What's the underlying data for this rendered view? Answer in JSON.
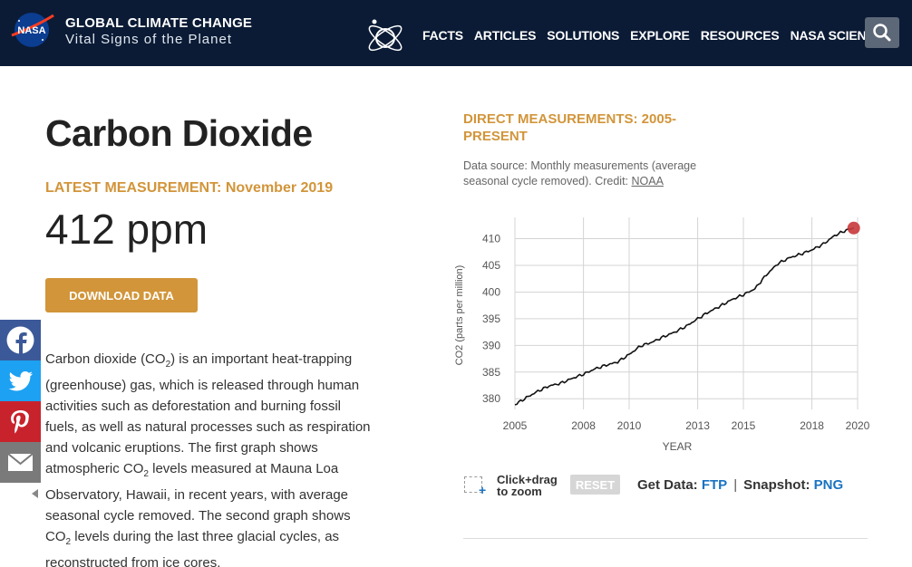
{
  "header": {
    "logo_text": "NASA",
    "title": "GLOBAL CLIMATE CHANGE",
    "subtitle": "Vital Signs of the Planet",
    "nav": [
      "FACTS",
      "ARTICLES",
      "SOLUTIONS",
      "EXPLORE",
      "RESOURCES",
      "NASA SCIENCE"
    ]
  },
  "main": {
    "title": "Carbon Dioxide",
    "latest_label": "LATEST MEASUREMENT: November 2019",
    "value": "412 ppm",
    "download_label": "DOWNLOAD DATA",
    "description": {
      "p1": "Carbon dioxide (CO",
      "sub": "2",
      "p2": ") is an important heat-trapping (greenhouse) gas, which is released through human activities such as deforestation and burning fossil fuels, as well as natural processes such as respiration and volcanic eruptions. The first graph shows atmospheric CO",
      "p3": " levels measured at Mauna Loa Observatory, Hawaii, in recent years, with average seasonal cycle removed. The second graph shows CO",
      "p4": " levels during the last three glacial cycles, as reconstructed from ice cores."
    }
  },
  "social": [
    "facebook-icon",
    "twitter-icon",
    "pinterest-icon",
    "email-icon"
  ],
  "chart_panel": {
    "heading": "DIRECT MEASUREMENTS: 2005-PRESENT",
    "source_text": "Data source: Monthly measurements (average seasonal cycle removed). Credit:",
    "source_link": "NOAA",
    "zoom_text_1": "Click+drag",
    "zoom_text_2": "to zoom",
    "reset_label": "RESET",
    "get_data_label": "Get Data:",
    "ftp_label": "FTP",
    "separator": "|",
    "snapshot_label": "Snapshot:",
    "png_label": "PNG"
  },
  "colors": {
    "header_bg": "#0b1b35",
    "accent": "#d2953a",
    "link": "#1a73c2",
    "highlight_point": "#c8393a"
  },
  "chart_data": {
    "type": "line",
    "title": "",
    "xlabel": "YEAR",
    "ylabel": "CO2 (parts per million)",
    "xlim": [
      2005,
      2020
    ],
    "ylim": [
      378,
      414
    ],
    "xticks": [
      2005,
      2008,
      2010,
      2013,
      2015,
      2018,
      2020
    ],
    "yticks": [
      380,
      385,
      390,
      395,
      400,
      405,
      410
    ],
    "grid": true,
    "x": [
      2005.0,
      2005.5,
      2006.0,
      2006.5,
      2007.0,
      2007.5,
      2008.0,
      2008.5,
      2009.0,
      2009.5,
      2010.0,
      2010.5,
      2011.0,
      2011.5,
      2012.0,
      2012.5,
      2013.0,
      2013.5,
      2014.0,
      2014.5,
      2015.0,
      2015.5,
      2016.0,
      2016.5,
      2017.0,
      2017.5,
      2018.0,
      2018.5,
      2019.0,
      2019.5,
      2019.83
    ],
    "y": [
      378.9,
      380.2,
      381.4,
      382.4,
      382.9,
      383.8,
      384.6,
      385.6,
      386.3,
      386.9,
      388.3,
      389.9,
      390.6,
      391.6,
      392.5,
      393.6,
      395.0,
      396.3,
      397.4,
      398.6,
      399.5,
      400.6,
      403.2,
      405.3,
      406.4,
      407.1,
      407.9,
      409.0,
      410.6,
      411.6,
      412.0
    ],
    "latest_point": {
      "x": 2019.83,
      "y": 412.0
    }
  }
}
